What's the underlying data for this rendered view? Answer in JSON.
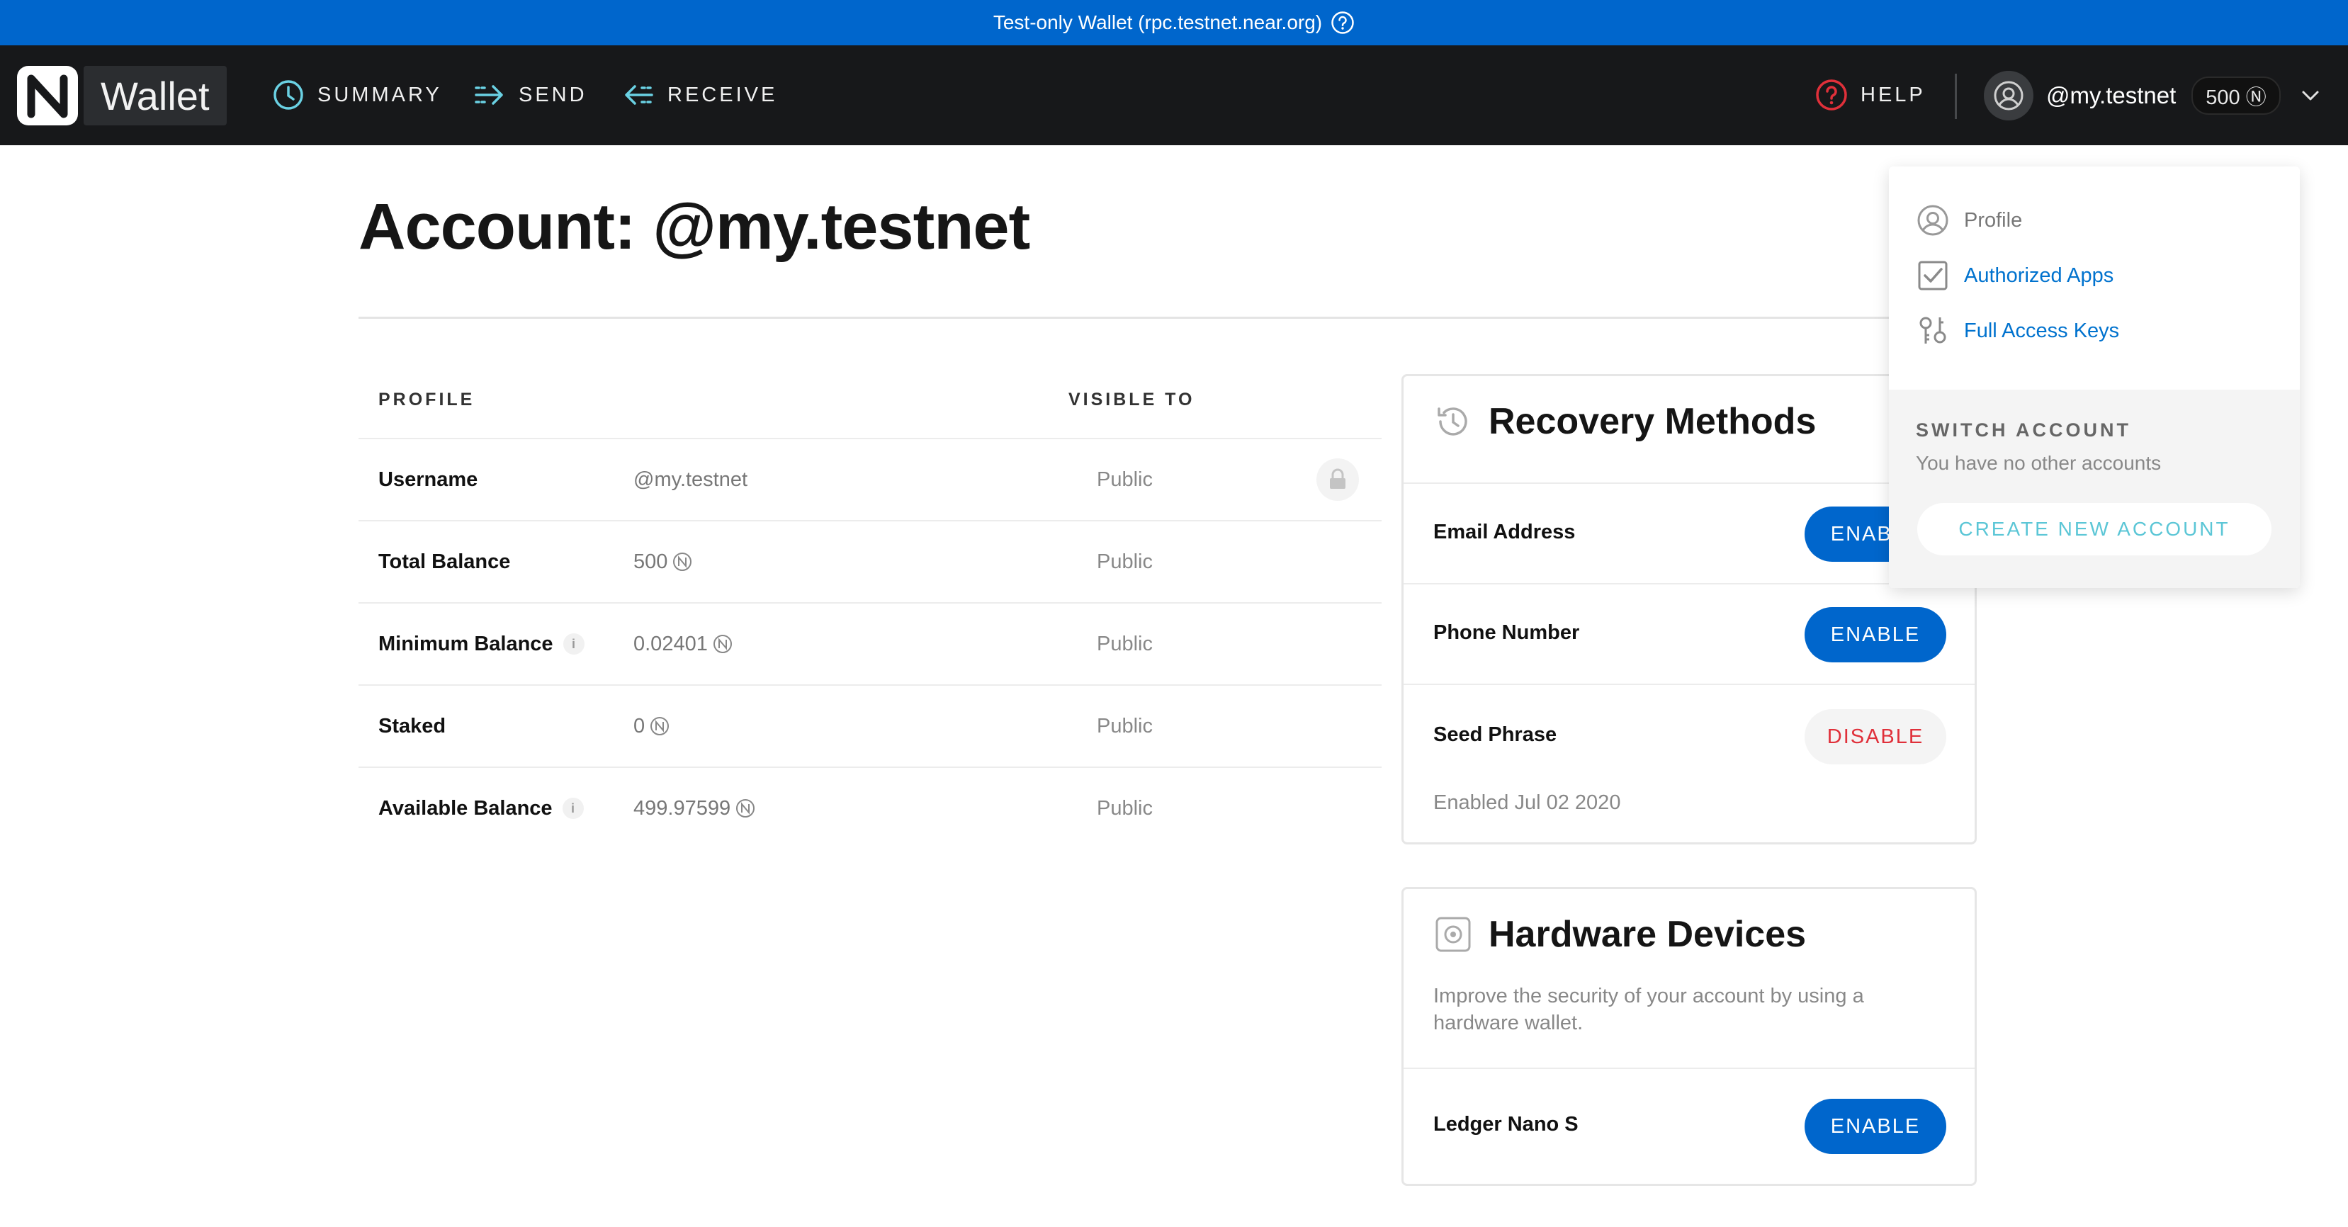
{
  "banner": {
    "text": "Test-only Wallet (rpc.testnet.near.org)",
    "help_icon": "question-circle-icon"
  },
  "nav": {
    "logo_text": "Wallet",
    "items": [
      {
        "label": "SUMMARY",
        "icon": "clock-icon"
      },
      {
        "label": "SEND",
        "icon": "send-arrow-icon"
      },
      {
        "label": "RECEIVE",
        "icon": "receive-arrow-icon"
      }
    ],
    "help_label": "HELP",
    "account_name": "@my.testnet",
    "account_balance": "500 Ⓝ"
  },
  "page": {
    "title": "Account: @my.testnet"
  },
  "profile": {
    "header_profile": "PROFILE",
    "header_visible": "VISIBLE TO",
    "rows": [
      {
        "label": "Username",
        "value": "@my.testnet",
        "visibility": "Public"
      },
      {
        "label": "Total Balance",
        "value": "500",
        "visibility": "Public"
      },
      {
        "label": "Minimum Balance",
        "value": "0.02401",
        "visibility": "Public"
      },
      {
        "label": "Staked",
        "value": "0",
        "visibility": "Public"
      },
      {
        "label": "Available Balance",
        "value": "499.97599",
        "visibility": "Public"
      }
    ],
    "info_glyph": "i"
  },
  "recovery": {
    "title": "Recovery Methods",
    "methods": [
      {
        "label": "Email Address",
        "action": "ENABLE"
      },
      {
        "label": "Phone Number",
        "action": "ENABLE"
      },
      {
        "label": "Seed Phrase",
        "action": "DISABLE"
      }
    ],
    "seed_enabled_note": "Enabled Jul 02 2020"
  },
  "hardware": {
    "title": "Hardware Devices",
    "description": "Improve the security of your account by using a hardware wallet.",
    "device_label": "Ledger Nano S",
    "device_action": "ENABLE"
  },
  "dropdown": {
    "items": [
      {
        "label": "Profile",
        "icon": "user-circle-icon"
      },
      {
        "label": "Authorized Apps",
        "icon": "checkbox-icon"
      },
      {
        "label": "Full Access Keys",
        "icon": "keys-icon"
      }
    ],
    "switch_title": "SWITCH ACCOUNT",
    "no_accounts": "You have no other accounts",
    "create_label": "CREATE NEW ACCOUNT"
  },
  "colors": {
    "banner": "#0066cc",
    "nav_bg": "#17181a",
    "nav_icon": "#6ad1e3",
    "primary": "#0066cc",
    "danger": "#e0303a",
    "link": "#0072ce"
  }
}
